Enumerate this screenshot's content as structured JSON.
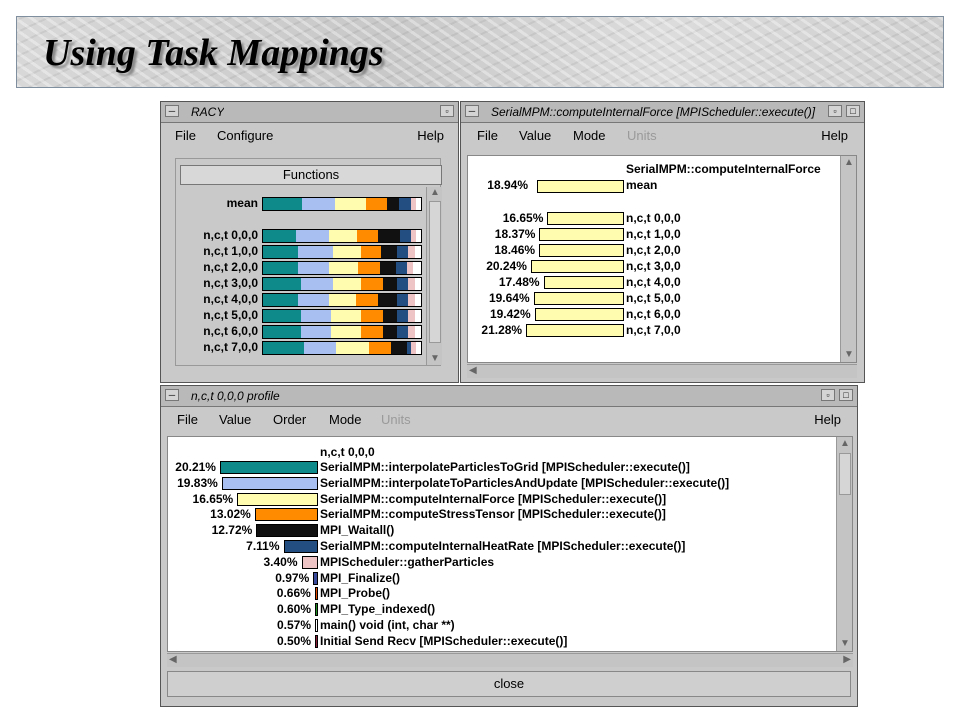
{
  "slide": {
    "title": "Using Task Mappings"
  },
  "racy": {
    "title": "RACY",
    "menus": [
      "File",
      "Configure",
      "Help"
    ],
    "functions_button": "Functions",
    "colors": [
      "#0e8a8a",
      "#a8bff2",
      "#fffcb0",
      "#ff8c00",
      "#111111",
      "#234e82",
      "#efc4c4",
      "#ffffff"
    ],
    "rows": [
      {
        "label": "mean",
        "segs": [
          0.23,
          0.2,
          0.18,
          0.13,
          0.07,
          0.07,
          0.03,
          0.03
        ]
      },
      {
        "label": "n,c,t 0,0,0",
        "segs": [
          0.2,
          0.2,
          0.17,
          0.13,
          0.13,
          0.07,
          0.03,
          0.03
        ]
      },
      {
        "label": "n,c,t 1,0,0",
        "segs": [
          0.22,
          0.22,
          0.18,
          0.13,
          0.1,
          0.07,
          0.04,
          0.04
        ]
      },
      {
        "label": "n,c,t 2,0,0",
        "segs": [
          0.22,
          0.2,
          0.18,
          0.14,
          0.1,
          0.07,
          0.04,
          0.05
        ]
      },
      {
        "label": "n,c,t 3,0,0",
        "segs": [
          0.24,
          0.2,
          0.18,
          0.14,
          0.09,
          0.07,
          0.04,
          0.04
        ]
      },
      {
        "label": "n,c,t 4,0,0",
        "segs": [
          0.22,
          0.2,
          0.17,
          0.14,
          0.12,
          0.07,
          0.04,
          0.04
        ]
      },
      {
        "label": "n,c,t 5,0,0",
        "segs": [
          0.24,
          0.19,
          0.19,
          0.14,
          0.09,
          0.07,
          0.04,
          0.04
        ]
      },
      {
        "label": "n,c,t 6,0,0",
        "segs": [
          0.24,
          0.19,
          0.19,
          0.14,
          0.09,
          0.07,
          0.04,
          0.04
        ]
      },
      {
        "label": "n,c,t 7,0,0",
        "segs": [
          0.26,
          0.2,
          0.21,
          0.14,
          0.1,
          0.03,
          0.03,
          0.03
        ]
      }
    ]
  },
  "func_window": {
    "title": "SerialMPM::computeInternalForce [MPIScheduler::execute()]",
    "menus": [
      "File",
      "Value",
      "Mode",
      "Units",
      "Help"
    ],
    "disabled_menu": "Units",
    "header": "SerialMPM::computeInternalForce",
    "bar_color": "#fffcb0",
    "mean": {
      "pct": "18.94%",
      "value": 18.94,
      "label": "mean"
    },
    "rows": [
      {
        "pct": "16.65%",
        "value": 16.65,
        "label": "n,c,t 0,0,0"
      },
      {
        "pct": "18.37%",
        "value": 18.37,
        "label": "n,c,t 1,0,0"
      },
      {
        "pct": "18.46%",
        "value": 18.46,
        "label": "n,c,t 2,0,0"
      },
      {
        "pct": "20.24%",
        "value": 20.24,
        "label": "n,c,t 3,0,0"
      },
      {
        "pct": "17.48%",
        "value": 17.48,
        "label": "n,c,t 4,0,0"
      },
      {
        "pct": "19.64%",
        "value": 19.64,
        "label": "n,c,t 5,0,0"
      },
      {
        "pct": "19.42%",
        "value": 19.42,
        "label": "n,c,t 6,0,0"
      },
      {
        "pct": "21.28%",
        "value": 21.28,
        "label": "n,c,t 7,0,0"
      }
    ]
  },
  "profile_window": {
    "title": "n,c,t 0,0,0 profile",
    "menus": [
      "File",
      "Value",
      "Order",
      "Mode",
      "Units",
      "Help"
    ],
    "disabled_menu": "Units",
    "header": "n,c,t 0,0,0",
    "close_label": "close",
    "rows": [
      {
        "pct": "20.21%",
        "value": 20.21,
        "color": "#0e8a8a",
        "name": "SerialMPM::interpolateParticlesToGrid [MPIScheduler::execute()]"
      },
      {
        "pct": "19.83%",
        "value": 19.83,
        "color": "#a8bff2",
        "name": "SerialMPM::interpolateToParticlesAndUpdate [MPIScheduler::execute()]"
      },
      {
        "pct": "16.65%",
        "value": 16.65,
        "color": "#fffcb0",
        "name": "SerialMPM::computeInternalForce [MPIScheduler::execute()]"
      },
      {
        "pct": "13.02%",
        "value": 13.02,
        "color": "#ff8c00",
        "name": "SerialMPM::computeStressTensor [MPIScheduler::execute()]"
      },
      {
        "pct": "12.72%",
        "value": 12.72,
        "color": "#111111",
        "name": "MPI_Waitall()"
      },
      {
        "pct": "7.11%",
        "value": 7.11,
        "color": "#234e82",
        "name": "SerialMPM::computeInternalHeatRate [MPIScheduler::execute()]"
      },
      {
        "pct": "3.40%",
        "value": 3.4,
        "color": "#efc4c4",
        "name": "MPIScheduler::gatherParticles"
      },
      {
        "pct": "0.97%",
        "value": 0.97,
        "color": "#3a4a9a",
        "name": "MPI_Finalize()"
      },
      {
        "pct": "0.66%",
        "value": 0.66,
        "color": "#e04a00",
        "name": "MPI_Probe()"
      },
      {
        "pct": "0.60%",
        "value": 0.6,
        "color": "#1f8f1f",
        "name": "MPI_Type_indexed()"
      },
      {
        "pct": "0.57%",
        "value": 0.57,
        "color": "#ffffff",
        "name": "main() void (int, char **)"
      },
      {
        "pct": "0.50%",
        "value": 0.5,
        "color": "#8a1f3a",
        "name": "Initial Send Recv [MPIScheduler::execute()]"
      }
    ]
  }
}
